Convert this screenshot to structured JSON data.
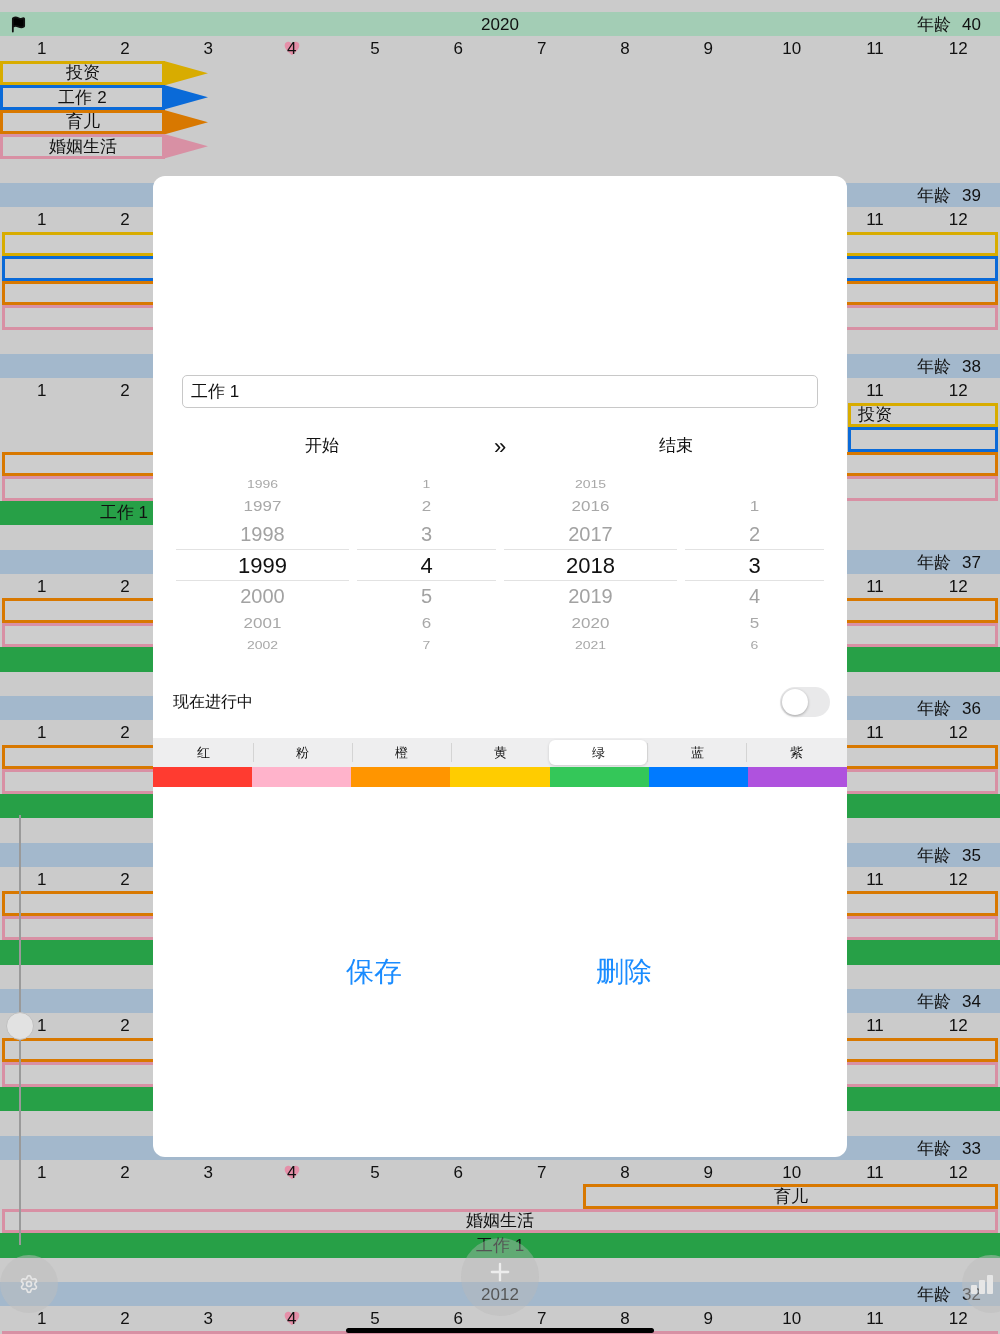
{
  "timeline": [
    {
      "current": true,
      "flag": true,
      "year": "2020",
      "age": "年龄 40",
      "months": [
        {
          "label": "1",
          "marked": false
        },
        {
          "label": "2",
          "marked": false
        },
        {
          "label": "3",
          "marked": false
        },
        {
          "label": "4",
          "marked": true
        },
        {
          "label": "5",
          "marked": false
        },
        {
          "label": "6",
          "marked": false
        },
        {
          "label": "7",
          "marked": false
        },
        {
          "label": "8",
          "marked": false
        },
        {
          "label": "9",
          "marked": false
        },
        {
          "label": "10",
          "marked": false
        },
        {
          "label": "11",
          "marked": false
        },
        {
          "label": "12",
          "marked": false
        }
      ],
      "rows": [
        {
          "kind": "arrow",
          "color": "#d8ac00",
          "label": "投资"
        },
        {
          "kind": "arrow",
          "color": "#0a6ad8",
          "label": "工作 2"
        },
        {
          "kind": "arrow",
          "color": "#d87800",
          "label": "育儿"
        },
        {
          "kind": "arrow",
          "color": "#d890a4",
          "label": "婚姻生活"
        }
      ]
    },
    {
      "current": false,
      "flag": false,
      "age": "年龄 39",
      "months": [
        {
          "label": "1",
          "marked": false
        },
        {
          "label": "2",
          "marked": false
        },
        {
          "label": "11",
          "marked": false
        },
        {
          "label": "12",
          "marked": false
        }
      ],
      "rows": [
        {
          "kind": "outline",
          "color": "#d8ac00"
        },
        {
          "kind": "outline",
          "color": "#0a6ad8"
        },
        {
          "kind": "outline",
          "color": "#d87800"
        },
        {
          "kind": "outline",
          "color": "#d890a4"
        }
      ]
    },
    {
      "current": false,
      "flag": false,
      "age": "年龄 38",
      "months": [
        {
          "label": "1",
          "marked": false
        },
        {
          "label": "2",
          "marked": false
        },
        {
          "label": "11",
          "marked": false
        },
        {
          "label": "12",
          "marked": false
        }
      ],
      "rows": [
        {
          "kind": "tail",
          "color": "#d8ac00",
          "label": "投资"
        },
        {
          "kind": "tail",
          "color": "#0a6ad8"
        },
        {
          "kind": "outline",
          "color": "#d87800"
        },
        {
          "kind": "outline",
          "color": "#d890a4"
        },
        {
          "kind": "early",
          "color": "#27a047",
          "label": "工作 1"
        }
      ]
    },
    {
      "current": false,
      "flag": false,
      "age": "年龄 37",
      "months": [
        {
          "label": "1",
          "marked": false
        },
        {
          "label": "2",
          "marked": false
        },
        {
          "label": "11",
          "marked": false
        },
        {
          "label": "12",
          "marked": false
        }
      ],
      "rows": [
        {
          "kind": "outline",
          "color": "#d87800"
        },
        {
          "kind": "outline",
          "color": "#d890a4"
        },
        {
          "kind": "filled",
          "color": "#27a047"
        }
      ]
    },
    {
      "current": false,
      "flag": false,
      "age": "年龄 36",
      "months": [
        {
          "label": "1",
          "marked": false
        },
        {
          "label": "2",
          "marked": false
        },
        {
          "label": "11",
          "marked": false
        },
        {
          "label": "12",
          "marked": false
        }
      ],
      "rows": [
        {
          "kind": "outline",
          "color": "#d87800"
        },
        {
          "kind": "outline",
          "color": "#d890a4"
        },
        {
          "kind": "filled",
          "color": "#27a047"
        }
      ]
    },
    {
      "current": false,
      "flag": false,
      "age": "年龄 35",
      "months": [
        {
          "label": "1",
          "marked": false
        },
        {
          "label": "2",
          "marked": false
        },
        {
          "label": "11",
          "marked": false
        },
        {
          "label": "12",
          "marked": false
        }
      ],
      "rows": [
        {
          "kind": "outline",
          "color": "#d87800"
        },
        {
          "kind": "outline",
          "color": "#d890a4"
        },
        {
          "kind": "filled",
          "color": "#27a047"
        }
      ]
    },
    {
      "current": false,
      "flag": false,
      "age": "年龄 34",
      "months": [
        {
          "label": "1",
          "marked": false
        },
        {
          "label": "2",
          "marked": false
        },
        {
          "label": "11",
          "marked": false
        },
        {
          "label": "12",
          "marked": false
        }
      ],
      "rows": [
        {
          "kind": "outline",
          "color": "#d87800"
        },
        {
          "kind": "outline",
          "color": "#d890a4"
        },
        {
          "kind": "filled",
          "color": "#27a047"
        }
      ]
    },
    {
      "current": false,
      "flag": false,
      "age": "年龄 33",
      "months": [
        {
          "label": "1",
          "marked": false
        },
        {
          "label": "2",
          "marked": false
        },
        {
          "label": "3",
          "marked": false
        },
        {
          "label": "4",
          "marked": true
        },
        {
          "label": "5",
          "marked": false
        },
        {
          "label": "6",
          "marked": false
        },
        {
          "label": "7",
          "marked": false
        },
        {
          "label": "8",
          "marked": false
        },
        {
          "label": "9",
          "marked": false
        },
        {
          "label": "10",
          "marked": false
        },
        {
          "label": "11",
          "marked": false
        },
        {
          "label": "12",
          "marked": false
        }
      ],
      "rows": [
        {
          "kind": "late",
          "color": "#d87800",
          "label": "育儿"
        },
        {
          "kind": "outline",
          "color": "#d890a4",
          "label": "婚姻生活"
        },
        {
          "kind": "filled",
          "color": "#27a047",
          "label": "工作 1"
        }
      ]
    },
    {
      "current": false,
      "flag": false,
      "year": "2012",
      "age": "年龄 32",
      "months": [
        {
          "label": "1",
          "marked": false
        },
        {
          "label": "2",
          "marked": false
        },
        {
          "label": "3",
          "marked": false
        },
        {
          "label": "4",
          "marked": true
        },
        {
          "label": "5",
          "marked": false
        },
        {
          "label": "6",
          "marked": false
        },
        {
          "label": "7",
          "marked": false
        },
        {
          "label": "8",
          "marked": false
        },
        {
          "label": "9",
          "marked": false
        },
        {
          "label": "10",
          "marked": false
        },
        {
          "label": "11",
          "marked": false
        },
        {
          "label": "12",
          "marked": false
        }
      ],
      "rows": [
        {
          "kind": "outline",
          "color": "#d890a4"
        }
      ]
    }
  ],
  "scrubber": {
    "level": 0.49
  },
  "editor": {
    "name_field": {
      "value": "工作 1"
    },
    "range_labels": {
      "start": "开始",
      "separator": "»",
      "end": "结束"
    },
    "pickers": [
      {
        "items": [
          {
            "label": "1996",
            "selected": false
          },
          {
            "label": "1997",
            "selected": false
          },
          {
            "label": "1998",
            "selected": false
          },
          {
            "label": "1999",
            "selected": true
          },
          {
            "label": "2000",
            "selected": false
          },
          {
            "label": "2001",
            "selected": false
          },
          {
            "label": "2002",
            "selected": false
          }
        ]
      },
      {
        "items": [
          {
            "label": "1",
            "selected": false
          },
          {
            "label": "2",
            "selected": false
          },
          {
            "label": "3",
            "selected": false
          },
          {
            "label": "4",
            "selected": true
          },
          {
            "label": "5",
            "selected": false
          },
          {
            "label": "6",
            "selected": false
          },
          {
            "label": "7",
            "selected": false
          }
        ]
      },
      {
        "items": [
          {
            "label": "2015",
            "selected": false
          },
          {
            "label": "2016",
            "selected": false
          },
          {
            "label": "2017",
            "selected": false
          },
          {
            "label": "2018",
            "selected": true
          },
          {
            "label": "2019",
            "selected": false
          },
          {
            "label": "2020",
            "selected": false
          },
          {
            "label": "2021",
            "selected": false
          }
        ]
      },
      {
        "items": [
          {
            "label": "1",
            "selected": false
          },
          {
            "label": "2",
            "selected": false
          },
          {
            "label": "3",
            "selected": true
          },
          {
            "label": "4",
            "selected": false
          },
          {
            "label": "5",
            "selected": false
          },
          {
            "label": "6",
            "selected": false
          }
        ]
      }
    ],
    "ongoing": {
      "label": "现在进行中",
      "on": false
    },
    "colors": [
      {
        "label": "红",
        "color": "#ff3b30",
        "selected": false
      },
      {
        "label": "粉",
        "color": "#ffb3cb",
        "selected": false
      },
      {
        "label": "橙",
        "color": "#ff9500",
        "selected": false
      },
      {
        "label": "黄",
        "color": "#ffcc00",
        "selected": false
      },
      {
        "label": "绿",
        "color": "#34c759",
        "selected": true
      },
      {
        "label": "蓝",
        "color": "#007aff",
        "selected": false
      },
      {
        "label": "紫",
        "color": "#af52de",
        "selected": false
      }
    ],
    "buttons": [
      {
        "label": "保存"
      },
      {
        "label": "删除"
      }
    ]
  }
}
